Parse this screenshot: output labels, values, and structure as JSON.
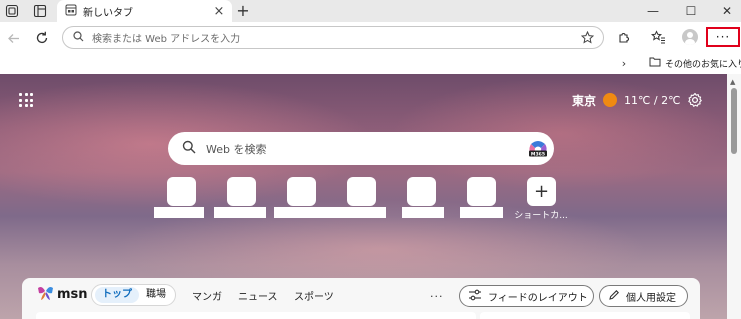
{
  "browser": {
    "tab": {
      "title": "新しいタブ",
      "close": "×"
    },
    "new_tab": "+",
    "window_controls": {
      "minimize": "—",
      "maximize": "☐",
      "close": "✕"
    },
    "address_bar": {
      "placeholder": "検索または Web アドレスを入力"
    },
    "more_menu": "···",
    "favorites_bar": {
      "chevron": "›",
      "other_favorites": "その他のお気に入り"
    }
  },
  "new_tab_page": {
    "weather": {
      "city": "東京",
      "temperature": "11℃ / 2℃"
    },
    "search": {
      "placeholder": "Web を検索"
    },
    "quick_links": {
      "add_label": "ショートカ...",
      "add_symbol": "+"
    }
  },
  "feed": {
    "logo": "msn",
    "tabs": [
      {
        "label": "トップ",
        "active": true
      },
      {
        "label": "職場",
        "active": false
      }
    ],
    "nav": [
      "マンガ",
      "ニュース",
      "スポーツ"
    ],
    "more": "...",
    "feed_layout_button": "フィードのレイアウト",
    "personalize_button": "個人用設定"
  },
  "colors": {
    "highlight_box": "#e0001b",
    "active_pill_text": "#0f6cbd",
    "sun": "#f08a12"
  }
}
